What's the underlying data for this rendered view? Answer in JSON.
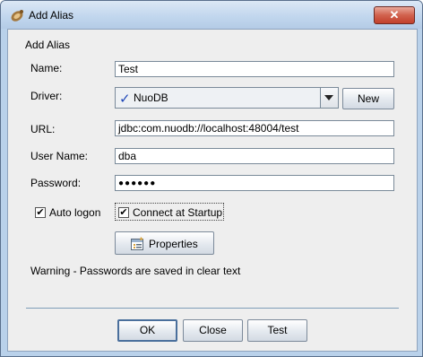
{
  "window": {
    "title": "Add Alias",
    "close_label": "✕"
  },
  "panel_title": "Add Alias",
  "form": {
    "name_label": "Name:",
    "name_value": "Test",
    "driver_label": "Driver:",
    "driver_value": "NuoDB",
    "driver_check": "✓",
    "new_button": "New",
    "url_label": "URL:",
    "url_value": "jdbc:com.nuodb://localhost:48004/test",
    "user_label": "User Name:",
    "user_value": "dba",
    "password_label": "Password:",
    "password_value": "●●●●●●",
    "auto_logon_label": "Auto logon",
    "auto_logon_checked": true,
    "connect_startup_label": "Connect at Startup",
    "connect_startup_checked": true,
    "checkmark": "✔",
    "properties_button": "Properties",
    "warning": "Warning - Passwords are saved in clear text"
  },
  "buttons": {
    "ok": "OK",
    "close": "Close",
    "test": "Test"
  },
  "colors": {
    "titlebar": "#c2d7ee",
    "client_bg": "#eeeeee",
    "check_blue": "#1f47b8",
    "close_red": "#c2402b"
  }
}
